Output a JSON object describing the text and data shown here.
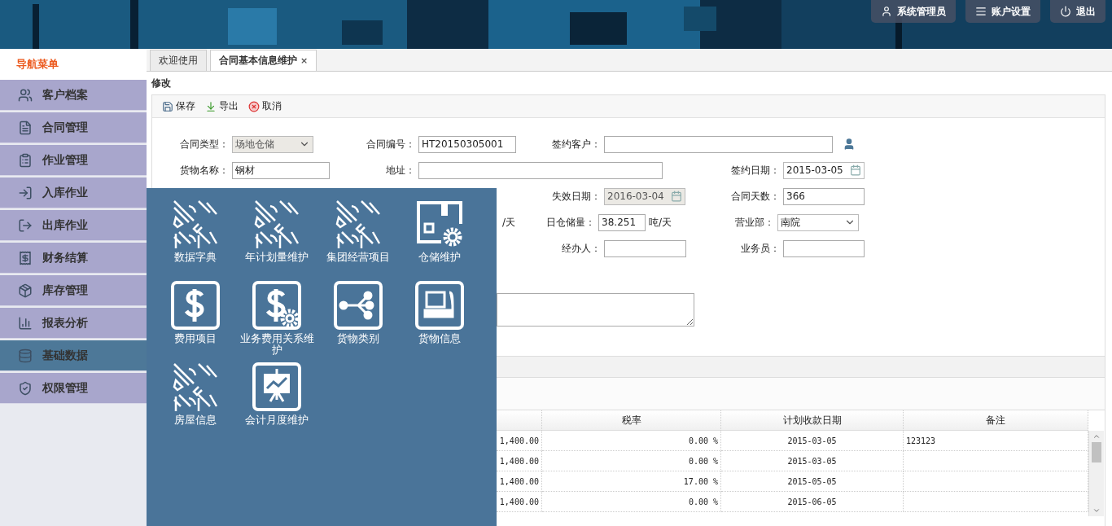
{
  "header": {
    "user_menu": [
      {
        "kind": "user",
        "label": "系统管理员"
      },
      {
        "kind": "settings",
        "label": "账户设置"
      },
      {
        "kind": "logout",
        "label": "退出"
      }
    ]
  },
  "sidebar": {
    "title": "导航菜单",
    "items": [
      {
        "label": "客户档案",
        "selected": false
      },
      {
        "label": "合同管理",
        "selected": false
      },
      {
        "label": "作业管理",
        "selected": false
      },
      {
        "label": "入库作业",
        "selected": false
      },
      {
        "label": "出库作业",
        "selected": false
      },
      {
        "label": "财务结算",
        "selected": false
      },
      {
        "label": "库存管理",
        "selected": false
      },
      {
        "label": "报表分析",
        "selected": false
      },
      {
        "label": "基础数据",
        "selected": true
      },
      {
        "label": "权限管理",
        "selected": false
      }
    ]
  },
  "tabs": [
    {
      "label": "欢迎使用",
      "selected": false
    },
    {
      "label": "合同基本信息维护",
      "selected": true,
      "close": "×"
    }
  ],
  "panel": {
    "title": "修改",
    "toolbar": [
      {
        "kind": "save",
        "label": "保存"
      },
      {
        "kind": "export",
        "label": "导出"
      },
      {
        "kind": "cancel",
        "label": "取消"
      }
    ]
  },
  "form": {
    "contract_type": {
      "label": "合同类型：",
      "value": "场地仓储",
      "disabled": true
    },
    "contract_no": {
      "label": "合同编号：",
      "value": "HT20150305001"
    },
    "customer": {
      "label": "签约客户："
    },
    "goods_name": {
      "label": "货物名称：",
      "value": "钢材"
    },
    "address": {
      "label": "地址："
    },
    "sign_date": {
      "label": "签约日期：",
      "value": "2015-03-05"
    },
    "expiry_date": {
      "label": "失效日期：",
      "value": "2016-03-04",
      "disabled": true
    },
    "contract_days": {
      "label": "合同天数：",
      "value": "366"
    },
    "unit_1": "/天",
    "daily_storage": {
      "label": "日仓储量：",
      "value": "38.251",
      "unit": "吨/天"
    },
    "department": {
      "label": "营业部：",
      "value": "南院"
    },
    "handler": {
      "label": "经办人："
    },
    "salesman": {
      "label": "业务员："
    }
  },
  "table": {
    "columns": [
      "税率",
      "计划收款日期",
      "备注"
    ],
    "rows": [
      {
        "column_1": "1,400.00",
        "tax_rate": "0.00 %",
        "planned_date": "2015-03-05",
        "remark": "123123"
      },
      {
        "column_1": "1,400.00",
        "tax_rate": "0.00 %",
        "planned_date": "2015-03-05"
      },
      {
        "column_1": "1,400.00",
        "tax_rate": "17.00 %",
        "planned_date": "2015-05-05"
      },
      {
        "column_1": "1,400.00",
        "tax_rate": "0.00 %",
        "planned_date": "2015-06-05"
      }
    ]
  },
  "popup_menu": {
    "items": [
      {
        "kind": "pattern",
        "label": "数据字典"
      },
      {
        "kind": "pattern",
        "label": "年计划量维护"
      },
      {
        "kind": "pattern",
        "label": "集团经营项目"
      },
      {
        "kind": "warehouse",
        "label": "仓储维护"
      },
      {
        "kind": "dollar",
        "label": "费用项目"
      },
      {
        "kind": "dollar-gear",
        "label": "业务费用关系维护"
      },
      {
        "kind": "share",
        "label": "货物类别"
      },
      {
        "kind": "truck",
        "label": "货物信息"
      },
      {
        "kind": "pattern",
        "label": "房屋信息"
      },
      {
        "kind": "chart",
        "label": "会计月度维护"
      }
    ]
  }
}
